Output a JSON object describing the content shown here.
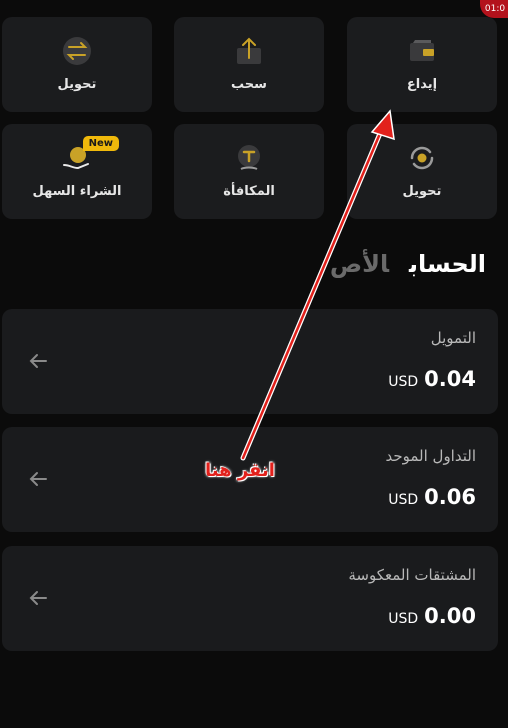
{
  "status": {
    "time": "01:0"
  },
  "actions": [
    {
      "label": "تحويل",
      "icon": "swap-icon"
    },
    {
      "label": "سحب",
      "icon": "withdraw-icon"
    },
    {
      "label": "إيداع",
      "icon": "deposit-wallet-icon"
    },
    {
      "label": "الشراء السهل",
      "icon": "easy-buy-icon",
      "badge": "New"
    },
    {
      "label": "المكافأة",
      "icon": "reward-icon"
    },
    {
      "label": "تحويل",
      "icon": "convert-icon"
    }
  ],
  "tabs": {
    "active": "الحساب",
    "inactive": "الأص"
  },
  "accounts": [
    {
      "title": "التمويل",
      "currency": "USD",
      "amount": "0.04"
    },
    {
      "title": "التداول الموحد",
      "currency": "USD",
      "amount": "0.06"
    },
    {
      "title": "المشتقات المعكوسة",
      "currency": "USD",
      "amount": "0.00"
    }
  ],
  "annotation": {
    "text": "انقر هنا",
    "color": "#e2211c"
  },
  "colors": {
    "background": "#0b0b0b",
    "card": "#1a1b1d",
    "accent": "#f0b90b",
    "annotation": "#e2211c"
  }
}
